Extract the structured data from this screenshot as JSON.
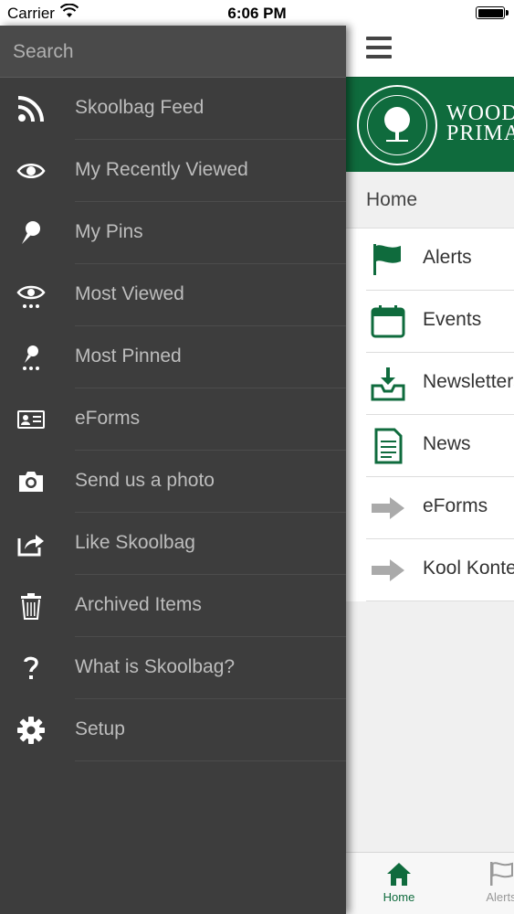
{
  "status_bar": {
    "carrier": "Carrier",
    "time": "6:06 PM"
  },
  "drawer": {
    "search": {
      "placeholder": "Search",
      "value": ""
    },
    "items": [
      {
        "label": "Skoolbag Feed",
        "icon": "rss-icon"
      },
      {
        "label": "My Recently Viewed",
        "icon": "eye-icon"
      },
      {
        "label": "My Pins",
        "icon": "pin-icon"
      },
      {
        "label": "Most Viewed",
        "icon": "eye-dots-icon"
      },
      {
        "label": "Most Pinned",
        "icon": "pin-dots-icon"
      },
      {
        "label": "eForms",
        "icon": "id-card-icon"
      },
      {
        "label": "Send us a photo",
        "icon": "camera-icon"
      },
      {
        "label": "Like Skoolbag",
        "icon": "share-icon"
      },
      {
        "label": "Archived Items",
        "icon": "trash-icon"
      },
      {
        "label": "What is Skoolbag?",
        "icon": "question-icon"
      },
      {
        "label": "Setup",
        "icon": "gear-icon"
      }
    ]
  },
  "main": {
    "banner": {
      "line1": "WOODVILLE",
      "line2": "PRIMARY SCHOOL",
      "color": "#0f6b3d"
    },
    "breadcrumb": "Home",
    "menu": [
      {
        "label": "Alerts",
        "icon": "flag-icon"
      },
      {
        "label": "Events",
        "icon": "calendar-icon"
      },
      {
        "label": "Newsletters",
        "icon": "inbox-download-icon"
      },
      {
        "label": "News",
        "icon": "document-icon"
      },
      {
        "label": "eForms",
        "icon": "arrow-right-icon"
      },
      {
        "label": "Kool Kontent",
        "icon": "arrow-right-icon"
      }
    ]
  },
  "tabbar": {
    "tabs": [
      {
        "label": "Home",
        "icon": "home-icon",
        "active": true
      },
      {
        "label": "Alerts",
        "icon": "flag-icon",
        "active": false
      }
    ]
  },
  "colors": {
    "accent": "#0f6b3d",
    "drawer_bg": "#3d3d3d",
    "drawer_text": "#bdbdbd"
  }
}
